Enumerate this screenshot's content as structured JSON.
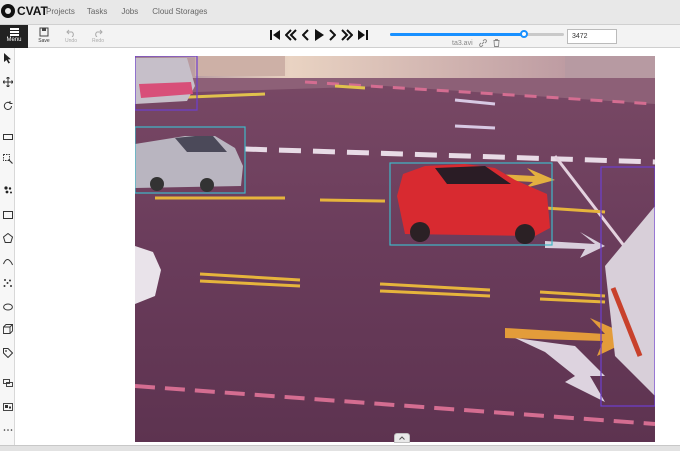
{
  "app": {
    "name": "CVAT"
  },
  "nav": {
    "items": [
      "Projects",
      "Tasks",
      "Jobs",
      "Cloud Storages"
    ]
  },
  "toolbar": {
    "menu_label": "Menu",
    "save_label": "Save",
    "undo_label": "Undo",
    "redo_label": "Redo"
  },
  "player": {
    "frame_number": "3472",
    "filename": "ta3.avi",
    "progress": 0.77,
    "controls": [
      "first-frame",
      "backward-step",
      "previous-frame",
      "play",
      "next-frame",
      "forward-step",
      "last-frame"
    ]
  },
  "sidebar": {
    "tools": [
      "cursor-icon",
      "move-icon",
      "rotate-icon",
      "fit-icon",
      "zoom-region-icon",
      "magic-wand-icon",
      "rectangle-icon",
      "polygon-icon",
      "polyline-icon",
      "points-icon",
      "ellipse-icon",
      "cuboid-icon",
      "tag-icon",
      "merge-icon",
      "group-icon",
      "split-icon"
    ]
  },
  "annotations": {
    "colors": {
      "cyan": "#3fb8c8",
      "purple": "#6d3fd0"
    },
    "boxes": [
      {
        "object": "car-silver",
        "color": "cyan"
      },
      {
        "object": "car-red",
        "color": "cyan"
      },
      {
        "object": "vehicle-top-left",
        "color": "purple"
      },
      {
        "object": "truck-right",
        "color": "purple"
      }
    ]
  },
  "colors": {
    "accent": "#1890ff",
    "menu_bg": "#222222",
    "topbar_bg": "#e8e8e8"
  }
}
